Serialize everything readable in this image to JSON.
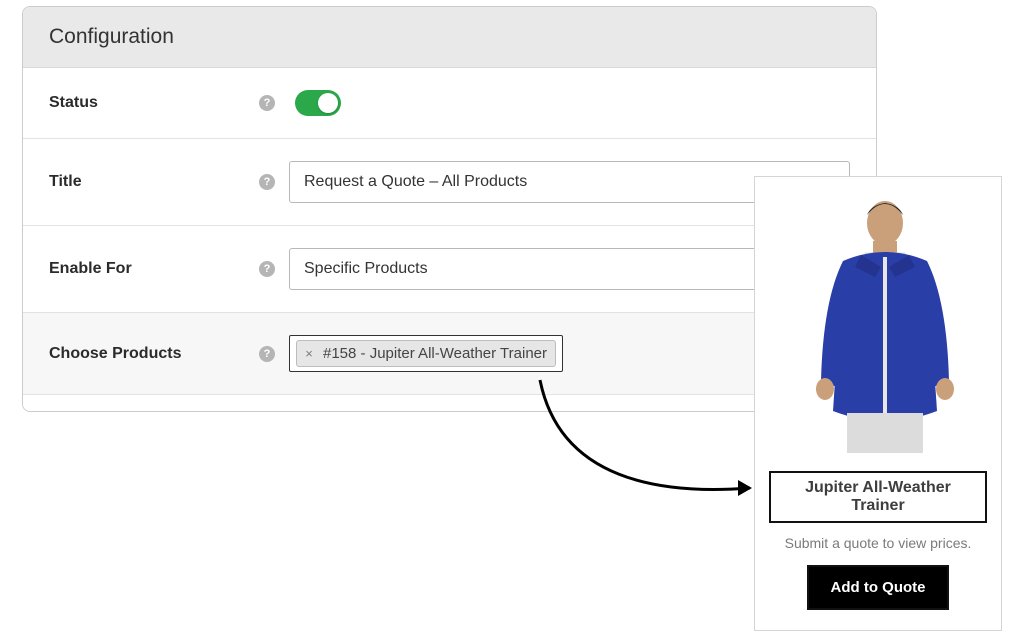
{
  "panel": {
    "title": "Configuration",
    "rows": {
      "status": {
        "label": "Status",
        "toggle_on": true
      },
      "title": {
        "label": "Title",
        "value": "Request a Quote – All Products"
      },
      "enable": {
        "label": "Enable For",
        "value": "Specific Products"
      },
      "products": {
        "label": "Choose Products",
        "chip": "#158 - Jupiter All-Weather Trainer"
      }
    }
  },
  "product_card": {
    "title": "Jupiter All-Weather Trainer",
    "subtitle": "Submit a quote to view prices.",
    "button": "Add to Quote"
  },
  "colors": {
    "toggle_on": "#2aa84a",
    "jacket": "#2a3ea8"
  }
}
